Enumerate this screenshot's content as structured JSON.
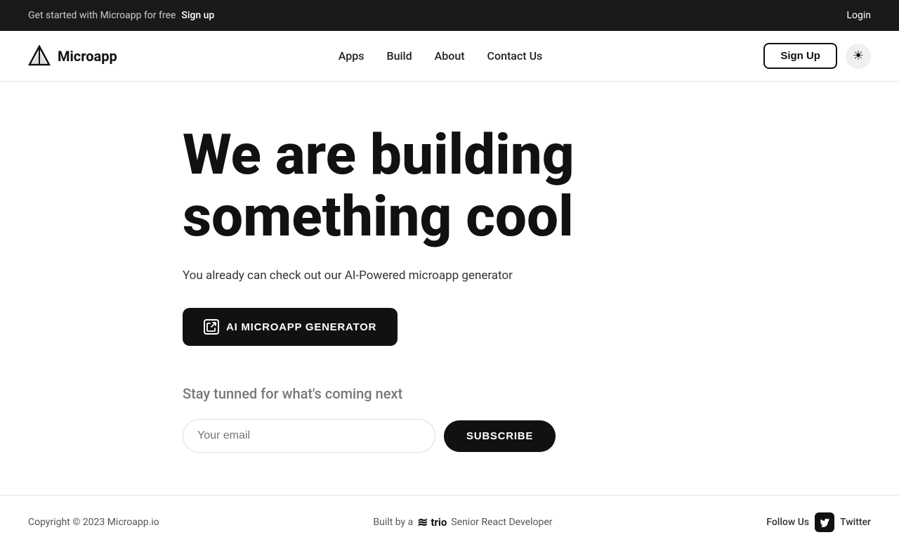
{
  "topbar": {
    "promo_text": "Get started with Microapp for free",
    "signup_link": "Sign up",
    "login_link": "Login"
  },
  "navbar": {
    "brand_name": "Microapp",
    "nav_links": [
      {
        "label": "Apps",
        "href": "#"
      },
      {
        "label": "Build",
        "href": "#"
      },
      {
        "label": "About",
        "href": "#"
      },
      {
        "label": "Contact Us",
        "href": "#"
      }
    ],
    "signup_button": "Sign Up",
    "theme_icon": "☀"
  },
  "hero": {
    "title_line1": "We are building",
    "title_line2": "something cool",
    "subtitle": "You already can check out our AI-Powered microapp generator",
    "ai_button_label": "AI MICROAPP GENERATOR",
    "stay_tuned": "Stay tunned for what's coming next",
    "email_placeholder": "Your email",
    "subscribe_button": "SUBSCRIBE"
  },
  "footer": {
    "copyright": "Copyright © 2023 Microapp.io",
    "built_by": "Built by a",
    "built_by_brand": "trio",
    "built_by_suffix": "Senior React Developer",
    "follow_us": "Follow Us",
    "twitter_label": "Twitter"
  }
}
